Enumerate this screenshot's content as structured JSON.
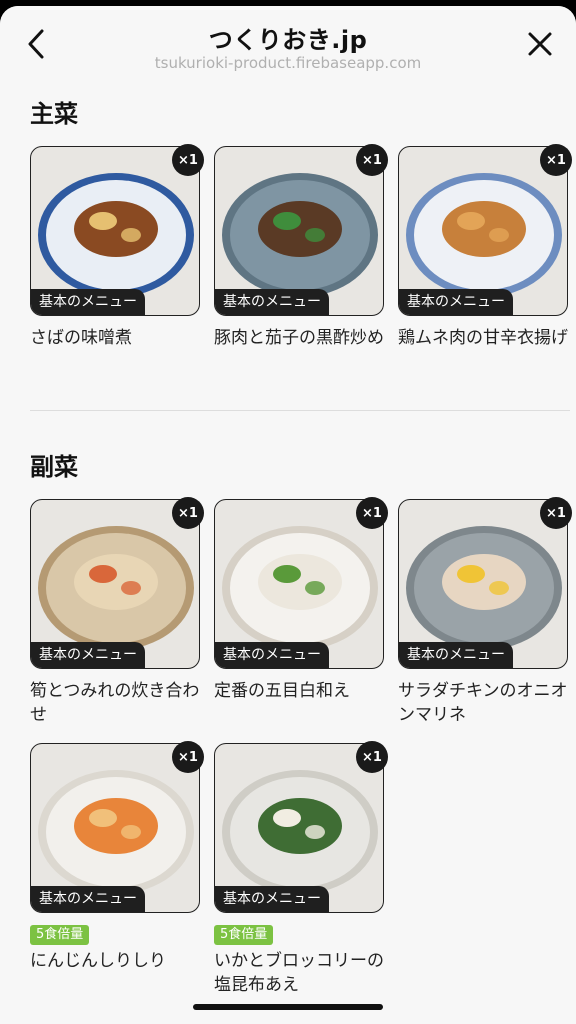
{
  "header": {
    "title": "つくりおき.jp",
    "url": "tsukurioki-product.firebaseapp.com",
    "back_icon": "chevron-left-icon",
    "close_icon": "close-icon"
  },
  "sections": [
    {
      "title": "主菜",
      "items": [
        {
          "name": "さばの味噌煮",
          "qty": "×1",
          "tag": "基本のメニュー",
          "plate": "#e9eef5",
          "rim": "#2f5aa0",
          "food": "#8a4a22",
          "accent": "#e6c071"
        },
        {
          "name": "豚肉と茄子の黒酢炒め",
          "qty": "×1",
          "tag": "基本のメニュー",
          "plate": "#7f95a3",
          "rim": "#5f7583",
          "food": "#5a3a25",
          "accent": "#3f8d3c"
        },
        {
          "name": "鶏ムネ肉の甘辛衣揚げ",
          "qty": "×1",
          "tag": "基本のメニュー",
          "plate": "#eef1f6",
          "rim": "#6d8dc0",
          "food": "#c7803b",
          "accent": "#e3a457"
        }
      ]
    },
    {
      "title": "副菜",
      "items": [
        {
          "name": "筍とつみれの炊き合わせ",
          "qty": "×1",
          "tag": "基本のメニュー",
          "plate": "#d9c7a8",
          "rim": "#b59a73",
          "food": "#e8d6b5",
          "accent": "#d9673a"
        },
        {
          "name": "定番の五目白和え",
          "qty": "×1",
          "tag": "基本のメニュー",
          "plate": "#f4f2ee",
          "rim": "#d6d0c6",
          "food": "#ece7dd",
          "accent": "#5a9a3a"
        },
        {
          "name": "サラダチキンのオニオンマリネ",
          "qty": "×1",
          "tag": "基本のメニュー",
          "plate": "#9aa3a8",
          "rim": "#7e878c",
          "food": "#e7d6c2",
          "accent": "#f0c436"
        },
        {
          "name": "にんじんしりしり",
          "qty": "×1",
          "tag": "基本のメニュー",
          "badge": "5食倍量",
          "plate": "#f2f0ec",
          "rim": "#dcd8d0",
          "food": "#e8853a",
          "accent": "#f1c07a"
        },
        {
          "name": "いかとブロッコリーの塩昆布あえ",
          "qty": "×1",
          "tag": "基本のメニュー",
          "badge": "5食倍量",
          "plate": "#e7e6e2",
          "rim": "#cfcdc6",
          "food": "#3f6d34",
          "accent": "#f1ede2"
        }
      ]
    }
  ]
}
